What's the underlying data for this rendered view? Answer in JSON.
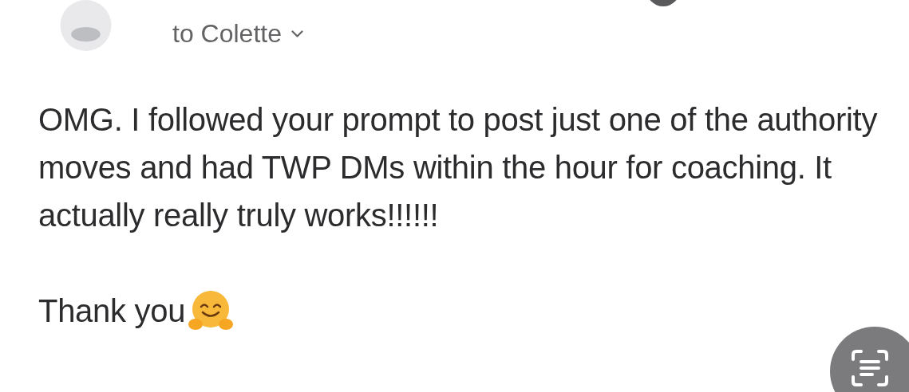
{
  "header": {
    "recipient": "to Colette"
  },
  "body": {
    "paragraphs": [
      "OMG. I followed your prompt to post just one of the authority moves and had TWP DMs within the hour for coaching. It actually really truly works!!!!!!",
      "Thank you"
    ]
  }
}
